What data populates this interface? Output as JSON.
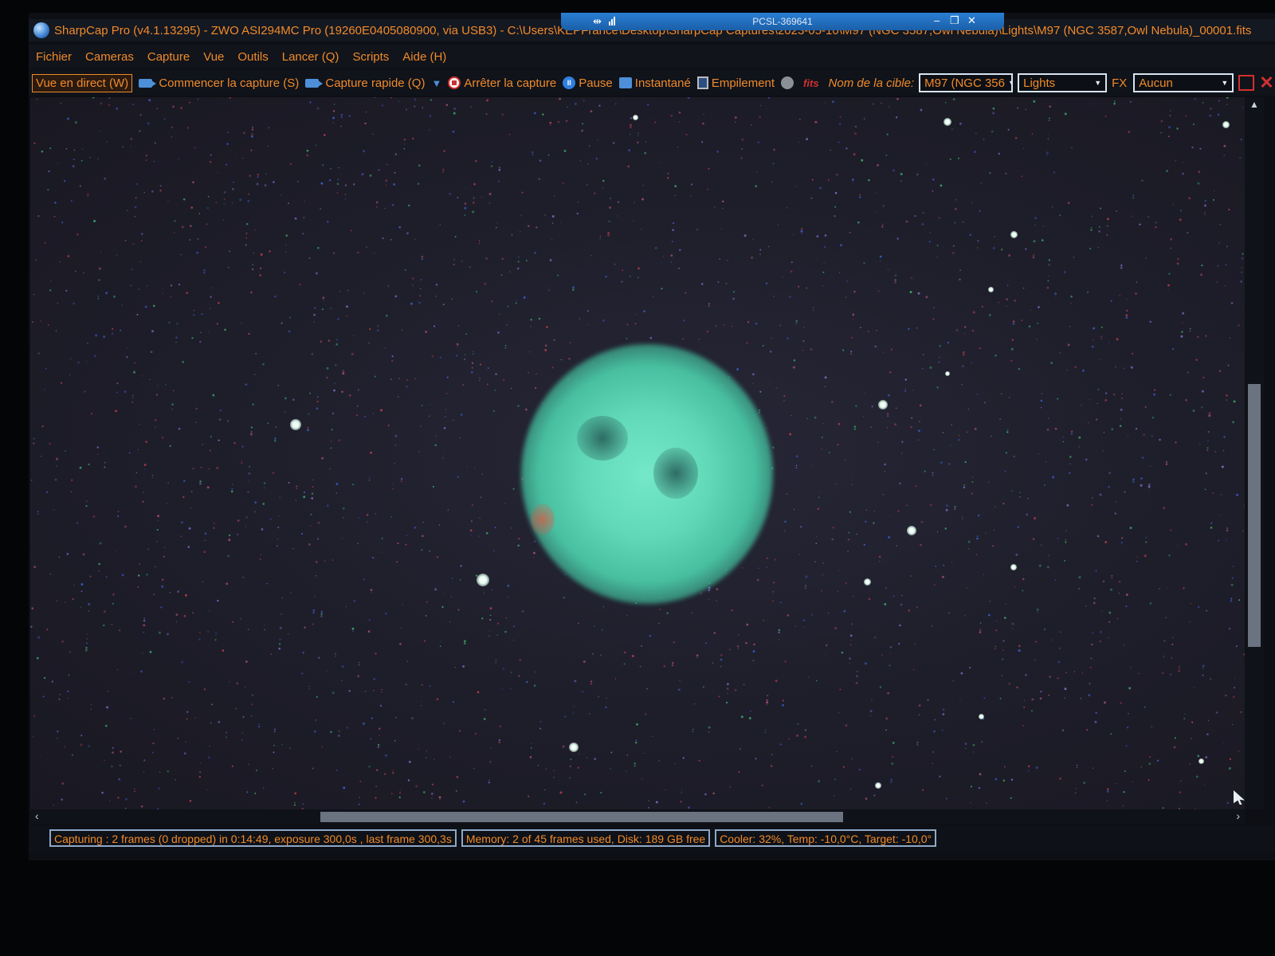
{
  "app": {
    "title": "SharpCap Pro (v4.1.13295) - ZWO ASI294MC Pro (19260E0405080900, via USB3) - C:\\Users\\KEPFrance\\Desktop\\SharpCap Captures\\2023-05-10\\M97 (NGC 3587,Owl Nebula)\\Lights\\M97 (NGC 3587,Owl Nebula)_00001.fits",
    "remote_host": "PCSL-369641"
  },
  "menu": [
    "Fichier",
    "Cameras",
    "Capture",
    "Vue",
    "Outils",
    "Lancer (Q)",
    "Scripts",
    "Aide (H)"
  ],
  "toolbar": {
    "live_view": "Vue en direct (W)",
    "start_capture": "Commencer la capture (S)",
    "quick_capture": "Capture rapide (Q)",
    "stop_capture": "Arrêter la capture",
    "pause": "Pause",
    "snapshot": "Instantané",
    "stacking": "Empilement",
    "target_label": "Nom de la cible:",
    "target_value": "M97 (NGC 356",
    "frame_type": "Lights",
    "fx_label": "FX",
    "fx_value": "Aucun"
  },
  "status": {
    "capturing": "Capturing : 2 frames (0 dropped) in 0:14:49, exposure 300,0s , last frame 300,3s",
    "memory": "Memory: 2 of 45 frames used, Disk: 189 GB free",
    "cooler": "Cooler: 32%, Temp: -10,0°C, Target: -10,0°"
  },
  "image": {
    "object": "M97 Owl Nebula",
    "nebula_color": "#61d9b8",
    "background_color": "#1f1f2c"
  },
  "colors": {
    "accent_text": "#f08a2a",
    "accent_blue": "#2f7fe0",
    "stop_red": "#d03030"
  },
  "icons": [
    "app-logo-icon",
    "camera-icon",
    "stop-icon",
    "pause-icon",
    "snapshot-icon",
    "stack-icon",
    "fits-icon",
    "close-icon"
  ]
}
